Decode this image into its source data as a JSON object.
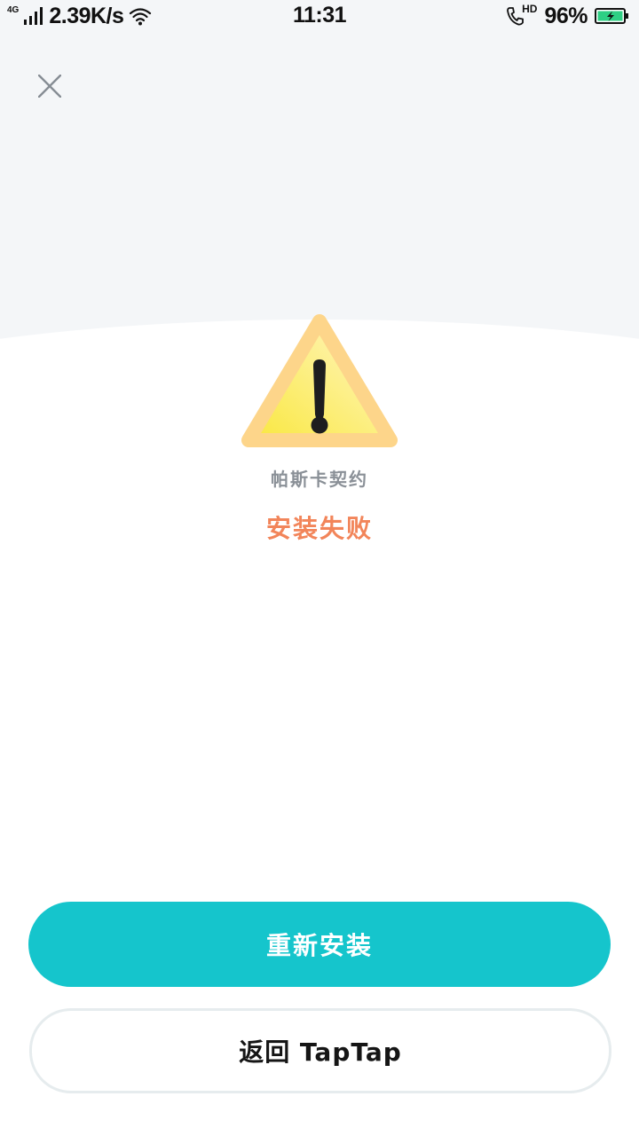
{
  "status_bar": {
    "network_type": "4G",
    "speed": "2.39K/s",
    "time": "11:31",
    "hd_label": "HD",
    "battery_percent": "96%",
    "battery_color": "#2ecf84"
  },
  "dialog": {
    "close_icon": "close-icon",
    "status_icon": "warning-icon",
    "app_name": "帕斯卡契约",
    "status_text": "安装失败",
    "status_color": "#f2855a"
  },
  "actions": {
    "reinstall_label": "重新安装",
    "reinstall_color": "#15c5cc",
    "back_label": "返回 TapTap"
  }
}
